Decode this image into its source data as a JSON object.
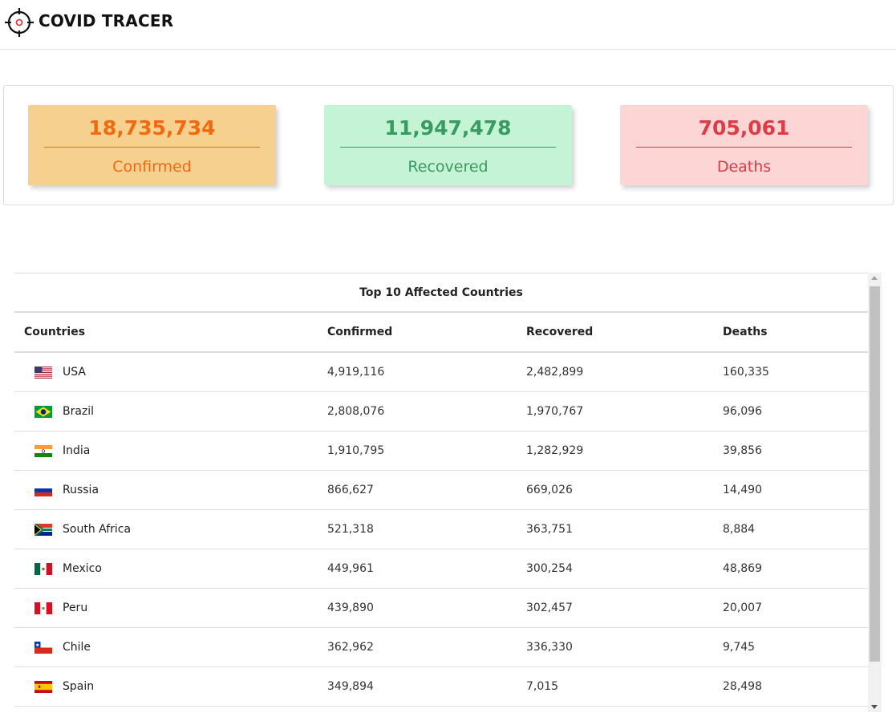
{
  "header": {
    "brand": "COVID TRACER",
    "logo_icon": "crosshair-target-icon"
  },
  "colors": {
    "confirmed_bg": "#f6d08e",
    "confirmed_fg": "#f26a10",
    "recovered_bg": "#c5f3d6",
    "recovered_fg": "#3a9a63",
    "deaths_bg": "#fdd5d5",
    "deaths_fg": "#dd3b45"
  },
  "stats": {
    "confirmed": {
      "value": "18,735,734",
      "label": "Confirmed"
    },
    "recovered": {
      "value": "11,947,478",
      "label": "Recovered"
    },
    "deaths": {
      "value": "705,061",
      "label": "Deaths"
    }
  },
  "table": {
    "title": "Top 10 Affected Countries",
    "headers": [
      "Countries",
      "Confirmed",
      "Recovered",
      "Deaths"
    ],
    "rows": [
      {
        "country": "USA",
        "flag": "us-flag-icon",
        "confirmed": "4,919,116",
        "recovered": "2,482,899",
        "deaths": "160,335"
      },
      {
        "country": "Brazil",
        "flag": "br-flag-icon",
        "confirmed": "2,808,076",
        "recovered": "1,970,767",
        "deaths": "96,096"
      },
      {
        "country": "India",
        "flag": "in-flag-icon",
        "confirmed": "1,910,795",
        "recovered": "1,282,929",
        "deaths": "39,856"
      },
      {
        "country": "Russia",
        "flag": "ru-flag-icon",
        "confirmed": "866,627",
        "recovered": "669,026",
        "deaths": "14,490"
      },
      {
        "country": "South Africa",
        "flag": "za-flag-icon",
        "confirmed": "521,318",
        "recovered": "363,751",
        "deaths": "8,884"
      },
      {
        "country": "Mexico",
        "flag": "mx-flag-icon",
        "confirmed": "449,961",
        "recovered": "300,254",
        "deaths": "48,869"
      },
      {
        "country": "Peru",
        "flag": "pe-flag-icon",
        "confirmed": "439,890",
        "recovered": "302,457",
        "deaths": "20,007"
      },
      {
        "country": "Chile",
        "flag": "cl-flag-icon",
        "confirmed": "362,962",
        "recovered": "336,330",
        "deaths": "9,745"
      },
      {
        "country": "Spain",
        "flag": "es-flag-icon",
        "confirmed": "349,894",
        "recovered": "7,015",
        "deaths": "28,498"
      }
    ]
  }
}
